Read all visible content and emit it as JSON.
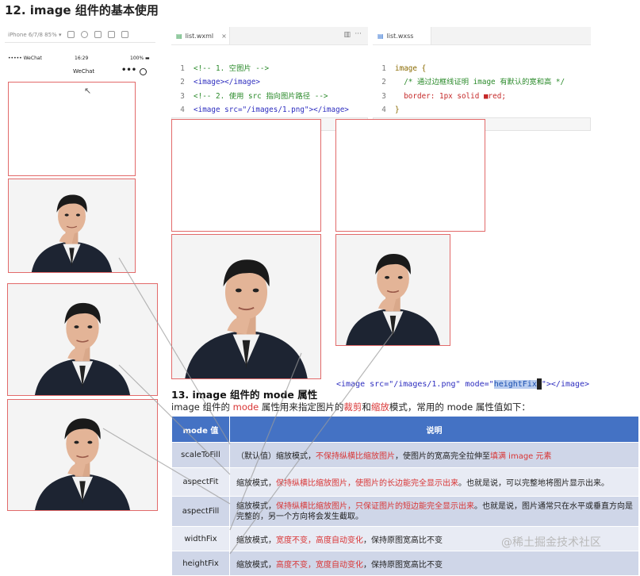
{
  "title": "12. image 组件的基本使用",
  "simulator": {
    "toolbar_label": "iPhone 6/7/8 85% ▾",
    "status_carrier": "••••• WeChat",
    "status_time": "16:29",
    "status_battery": "100% ▬",
    "nav_title": "WeChat",
    "nav_dots": "•••"
  },
  "wxml_editor": {
    "tab_label": "list.wxml",
    "lines": [
      {
        "n": "1",
        "text": "<!-- 1. 空图片 -->"
      },
      {
        "n": "2",
        "text": "<image></image>"
      },
      {
        "n": "3",
        "text": "<!-- 2. 使用 src 指向图片路径 -->"
      },
      {
        "n": "4",
        "text": "<image src=\"/images/1.png\"></image>"
      },
      {
        "n": "5",
        "text": ""
      }
    ]
  },
  "wxss_editor": {
    "tab_label": "list.wxss",
    "lines": [
      {
        "n": "1",
        "text": "image {"
      },
      {
        "n": "2",
        "text": "  /* 通过边框线证明 image 有默认的宽和高 */"
      },
      {
        "n": "3",
        "text": "  border: 1px solid ■red;"
      },
      {
        "n": "4",
        "text": "}"
      },
      {
        "n": "5",
        "text": ""
      }
    ]
  },
  "heightfix_code": {
    "before": "<image src=\"/images/1.png\" mode=\"",
    "highlight": "heightFix",
    "after": "\"></image>"
  },
  "section13": {
    "title": "13. image 组件的 mode 属性",
    "desc_1": "image 组件的 ",
    "desc_mode": "mode",
    "desc_2": " 属性用来指定图片的",
    "desc_crop": "裁剪",
    "desc_3": "和",
    "desc_scale": "缩放",
    "desc_4": "模式，常用的 mode 属性值如下："
  },
  "mode_table": {
    "headers": [
      "mode 值",
      "说明"
    ],
    "rows": [
      {
        "key": "scaleToFill",
        "p1": "（默认值）缩放模式，",
        "r1": "不保持纵横比缩放图片",
        "p2": "，使图片的宽高完全拉伸至",
        "r2": "填满 image 元素",
        "p3": ""
      },
      {
        "key": "aspectFit",
        "p1": "缩放模式，",
        "r1": "保持纵横比缩放图片，使图片的长边能完全显示出来",
        "p2": "。也就是说，可以完整地将图片显示出来。",
        "r2": "",
        "p3": ""
      },
      {
        "key": "aspectFill",
        "p1": "缩放模式，",
        "r1": "保持纵横比缩放图片，只保证图片的短边能完全显示出来",
        "p2": "。也就是说，图片通常只在水平或垂直方向是完整的，另一个方向将会发生截取。",
        "r2": "",
        "p3": ""
      },
      {
        "key": "widthFix",
        "p1": "缩放模式，",
        "r1": "宽度不变，高度自动变化",
        "p2": "，保持原图宽高比不变",
        "r2": "",
        "p3": ""
      },
      {
        "key": "heightFix",
        "p1": "缩放模式，",
        "r1": "高度不变，宽度自动变化",
        "p2": "，保持原图宽高比不变",
        "r2": "",
        "p3": ""
      }
    ]
  },
  "watermark": "@稀土掘金技术社区",
  "colors": {
    "accent": "#4472c4",
    "border_red": "#e26a6a",
    "highlight_red": "#d93535"
  }
}
